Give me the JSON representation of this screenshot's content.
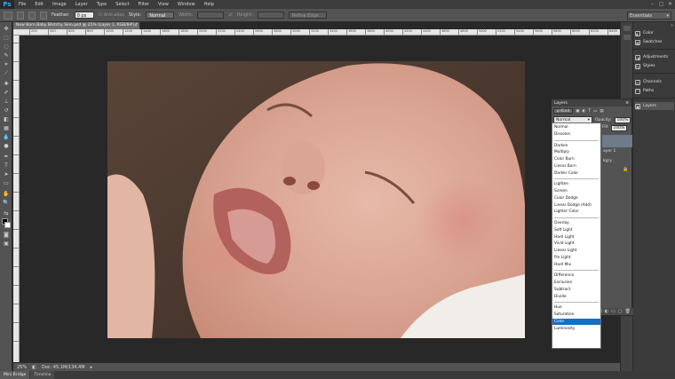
{
  "app": {
    "logo": "Ps"
  },
  "menu": [
    "File",
    "Edit",
    "Image",
    "Layer",
    "Type",
    "Select",
    "Filter",
    "View",
    "Window",
    "Help"
  ],
  "window_controls": [
    "–",
    "▢",
    "✕"
  ],
  "options": {
    "feather_label": "Feather:",
    "feather_value": "0 px",
    "antialias_label": "Anti-alias",
    "style_label": "Style:",
    "style_value": "Normal",
    "width_label": "Width:",
    "height_label": "Height:",
    "refine_label": "Refine Edge...",
    "workspace": "Essentials"
  },
  "document": {
    "tab_title": "New Born Baby Blotchy Skin.psd @ 25% (Layer 1, RGB/8#) *",
    "close": "×",
    "zoom": "25%",
    "doc_info": "Doc: 45.1M/134.4M"
  },
  "ruler_labels": [
    "200",
    "400",
    "600",
    "800",
    "1000",
    "1200",
    "1400",
    "1600",
    "1800",
    "2000",
    "2200",
    "2400",
    "2600",
    "2800",
    "3000",
    "3200",
    "3400",
    "3600",
    "3800",
    "4000",
    "4200",
    "4400",
    "4600",
    "4800",
    "5000",
    "5200",
    "5400",
    "5600",
    "5800",
    "6000",
    "6200",
    "6400"
  ],
  "bottom_tabs": [
    "Mini Bridge",
    "Timeline"
  ],
  "dock": {
    "items": [
      {
        "label": "Color",
        "icon": "color-icon"
      },
      {
        "label": "Swatches",
        "icon": "swatches-icon"
      },
      {
        "label": "Adjustments",
        "icon": "adjustments-icon"
      },
      {
        "label": "Styles",
        "icon": "styles-icon"
      },
      {
        "label": "Channels",
        "icon": "channels-icon"
      },
      {
        "label": "Paths",
        "icon": "paths-icon"
      },
      {
        "label": "Layers",
        "icon": "layers-icon"
      }
    ]
  },
  "layers": {
    "title": "Layers",
    "filter_kind": "ρ Kind",
    "blend_mode": "Normal",
    "opacity_label": "Opacity:",
    "opacity_value": "100%",
    "fill_label": "Fill:",
    "fill_value": "100%",
    "layer_1": "ayer 1",
    "layer_2": "kgry"
  },
  "blend_modes": {
    "groups": [
      [
        "Normal",
        "Dissolve"
      ],
      [
        "Darken",
        "Multiply",
        "Color Burn",
        "Linear Burn",
        "Darker Color"
      ],
      [
        "Lighten",
        "Screen",
        "Color Dodge",
        "Linear Dodge (Add)",
        "Lighter Color"
      ],
      [
        "Overlay",
        "Soft Light",
        "Hard Light",
        "Vivid Light",
        "Linear Light",
        "Pin Light",
        "Hard Mix"
      ],
      [
        "Difference",
        "Exclusion",
        "Subtract",
        "Divide"
      ],
      [
        "Hue",
        "Saturation",
        "Color",
        "Luminosity"
      ]
    ],
    "selected": "Color"
  },
  "colors": {
    "accent": "#1a6ec2",
    "ps_blue": "#31a8ff"
  }
}
